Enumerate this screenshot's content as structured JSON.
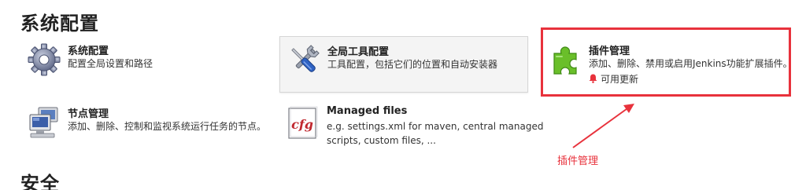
{
  "sections": {
    "config_title": "系统配置",
    "security_title": "安全"
  },
  "tiles": {
    "system_config": {
      "name": "系统配置",
      "desc": "配置全局设置和路径"
    },
    "global_tools": {
      "name": "全局工具配置",
      "desc": "工具配置，包括它们的位置和自动安装器"
    },
    "plugin_manager": {
      "name": "插件管理",
      "desc": "添加、删除、禁用或启用Jenkins功能扩展插件。",
      "notice": "可用更新"
    },
    "node_manager": {
      "name": "节点管理",
      "desc": "添加、删除、控制和监视系统运行任务的节点。"
    },
    "managed_files": {
      "name": "Managed files",
      "desc_line1": "e.g. settings.xml for maven, central managed",
      "desc_line2": "scripts, custom files, ..."
    }
  },
  "annotation": {
    "label": "插件管理"
  },
  "colors": {
    "annotation_red": "#e8323c",
    "plugin_green": "#6abf2a",
    "hover_bg": "#f4f4f4"
  },
  "icons": [
    "gear-icon",
    "tools-icon",
    "puzzle-icon",
    "computer-icon",
    "cfg-file-icon",
    "bell-icon"
  ]
}
